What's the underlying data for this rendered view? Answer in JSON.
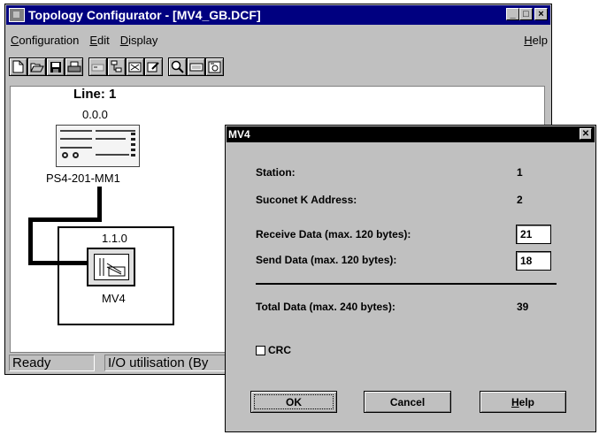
{
  "app": {
    "title": "Topology Configurator - [MV4_GB.DCF]",
    "window_buttons": [
      "_",
      "□",
      "×"
    ]
  },
  "menu": {
    "items": [
      {
        "prefix": "",
        "underline": "C",
        "rest": "onfiguration"
      },
      {
        "prefix": "",
        "underline": "E",
        "rest": "dit"
      },
      {
        "prefix": "",
        "underline": "D",
        "rest": "isplay"
      }
    ],
    "help": {
      "underline": "H",
      "rest": "elp"
    }
  },
  "toolbar": {
    "icons": [
      "new-file-icon",
      "open-folder-icon",
      "save-disk-icon",
      "print-icon",
      "station-icon",
      "tree-icon",
      "network-icon",
      "properties-icon",
      "zoom-icon",
      "keyboard-icon",
      "info-icon"
    ]
  },
  "topology": {
    "line_label": "Line: 1",
    "master_address": "0.0.0",
    "master_name": "PS4-201-MM1",
    "slave_address": "1.1.0",
    "slave_name": "MV4"
  },
  "status": {
    "ready": "Ready",
    "io": "I/O utilisation (By"
  },
  "dialog": {
    "title": "MV4",
    "station_label": "Station:",
    "station_value": "1",
    "suconet_label": "Suconet K Address:",
    "suconet_value": "2",
    "receive_label": "Receive Data (max. 120 bytes):",
    "receive_value": "21",
    "send_label": "Send Data (max. 120 bytes):",
    "send_value": "18",
    "total_label": "Total Data (max. 240 bytes):",
    "total_value": "39",
    "crc_label": "CRC",
    "crc_checked": false,
    "ok": "OK",
    "cancel": "Cancel",
    "help_underline": "H",
    "help_rest": "elp"
  }
}
